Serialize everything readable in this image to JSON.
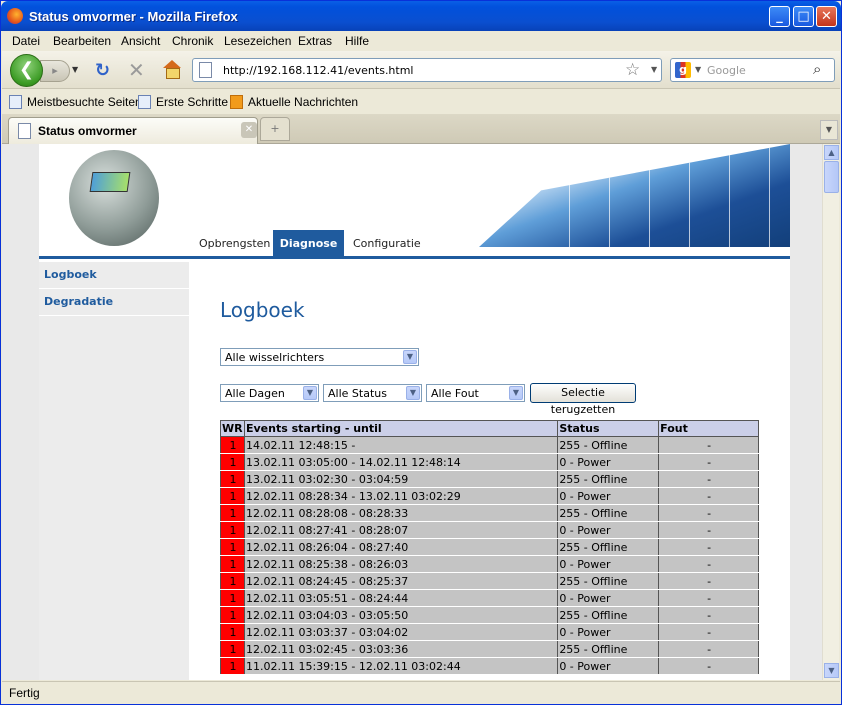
{
  "window": {
    "title": "Status omvormer - Mozilla Firefox",
    "minimize": "_",
    "maximize": "□",
    "close": "✕"
  },
  "menu": [
    "Datei",
    "Bearbeiten",
    "Ansicht",
    "Chronik",
    "Lesezeichen",
    "Extras",
    "Hilfe"
  ],
  "nav": {
    "url": "http://192.168.112.41/events.html",
    "search_placeholder": "Google"
  },
  "bookmarks": [
    "Meistbesuchte Seiten",
    "Erste Schritte",
    "Aktuelle Nachrichten"
  ],
  "tab": {
    "title": "Status omvormer"
  },
  "status": "Fertig",
  "site": {
    "nav_tabs": [
      "Opbrengsten",
      "Diagnose",
      "Configuratie"
    ],
    "active_tab": "Diagnose",
    "sidebar": [
      "Logboek",
      "Degradatie"
    ],
    "heading": "Logboek",
    "filters": {
      "inverter": "Alle wisselrichters",
      "days": "Alle Dagen",
      "status": "Alle Status",
      "fault": "Alle Fout",
      "reset": "Selectie terugzetten"
    },
    "table": {
      "headers": [
        "WR",
        "Events starting - until",
        "Status",
        "Fout"
      ],
      "rows": [
        [
          "1",
          "14.02.11 12:48:15 -",
          "255 - Offline",
          "-"
        ],
        [
          "1",
          "13.02.11 03:05:00 - 14.02.11 12:48:14",
          "0 - Power",
          "-"
        ],
        [
          "1",
          "13.02.11 03:02:30 - 03:04:59",
          "255 - Offline",
          "-"
        ],
        [
          "1",
          "12.02.11 08:28:34 - 13.02.11 03:02:29",
          "0 - Power",
          "-"
        ],
        [
          "1",
          "12.02.11 08:28:08 - 08:28:33",
          "255 - Offline",
          "-"
        ],
        [
          "1",
          "12.02.11 08:27:41 - 08:28:07",
          "0 - Power",
          "-"
        ],
        [
          "1",
          "12.02.11 08:26:04 - 08:27:40",
          "255 - Offline",
          "-"
        ],
        [
          "1",
          "12.02.11 08:25:38 - 08:26:03",
          "0 - Power",
          "-"
        ],
        [
          "1",
          "12.02.11 08:24:45 - 08:25:37",
          "255 - Offline",
          "-"
        ],
        [
          "1",
          "12.02.11 03:05:51 - 08:24:44",
          "0 - Power",
          "-"
        ],
        [
          "1",
          "12.02.11 03:04:03 - 03:05:50",
          "255 - Offline",
          "-"
        ],
        [
          "1",
          "12.02.11 03:03:37 - 03:04:02",
          "0 - Power",
          "-"
        ],
        [
          "1",
          "12.02.11 03:02:45 - 03:03:36",
          "255 - Offline",
          "-"
        ],
        [
          "1",
          "11.02.11 15:39:15 - 12.02.11 03:02:44",
          "0 - Power",
          "-"
        ]
      ]
    }
  }
}
